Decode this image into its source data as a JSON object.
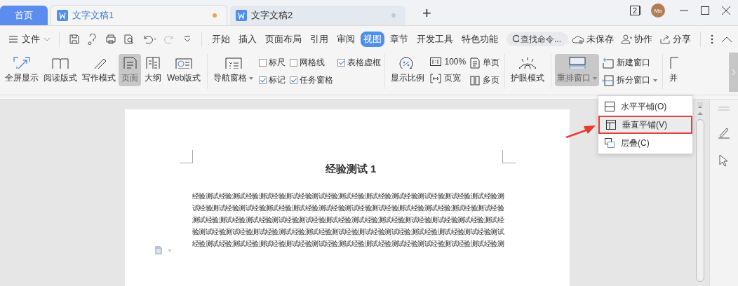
{
  "tab_bar": {
    "home_tab": "首页",
    "doc_tabs": [
      {
        "title": "文字文稿1",
        "selected": true,
        "modified": true
      },
      {
        "title": "文字文稿2",
        "selected": false,
        "modified": false
      }
    ],
    "add_tab": "+",
    "window_count": "2",
    "avatar": "Ma"
  },
  "menu_bar": {
    "file_menu": "文件",
    "tabs": [
      {
        "label": "开始",
        "selected": false
      },
      {
        "label": "插入",
        "selected": false
      },
      {
        "label": "页面布局",
        "selected": false
      },
      {
        "label": "引用",
        "selected": false
      },
      {
        "label": "审阅",
        "selected": false
      },
      {
        "label": "视图",
        "selected": true
      },
      {
        "label": "章节",
        "selected": false
      },
      {
        "label": "开发工具",
        "selected": false
      },
      {
        "label": "特色功能",
        "selected": false
      }
    ],
    "search": {
      "placeholder": "查找命令..."
    },
    "actions": [
      "未保存",
      "协作",
      "分享"
    ]
  },
  "ribbon": {
    "view_modes": [
      {
        "label": "全屏显示",
        "selected": false
      },
      {
        "label": "阅读版式",
        "selected": false
      },
      {
        "label": "写作模式",
        "selected": false
      },
      {
        "label": "页面",
        "selected": true
      },
      {
        "label": "大纲",
        "selected": false
      },
      {
        "label": "Web版式",
        "selected": false
      }
    ],
    "nav_pane": "导航窗格",
    "checkboxes": [
      {
        "label": "标尺",
        "checked": false
      },
      {
        "label": "网格线",
        "checked": false
      },
      {
        "label": "表格虚框",
        "checked": true
      },
      {
        "label": "标记",
        "checked": true
      },
      {
        "label": "任务窗格",
        "checked": true
      }
    ],
    "zoom": "显示比例",
    "zoom_options": [
      "100%",
      "页宽"
    ],
    "page_options": [
      "单页",
      "多页"
    ],
    "eye_mode": "护眼模式",
    "arrange": {
      "label": "重排窗口",
      "selected": true
    },
    "window_options": [
      "新建窗口",
      "拆分窗口"
    ],
    "side_by_side": "并"
  },
  "arrange_menu": [
    {
      "label": "水平平铺(O)",
      "selected": false
    },
    {
      "label": "垂直平铺(V)",
      "selected": true
    },
    {
      "label": "层叠(C)",
      "selected": false
    }
  ],
  "document": {
    "title": "经验测试 1",
    "lines": [
      "经验测试经验测试经验测试经验测试经验测试经验测试经验测试经验测试经验测试经验测试经验测试经验测",
      "试经验测试经验测试经验测试经验测试经验测试经验测试经验测试经验测试经验测试经验测试经验测试经验",
      "测试经验测试经验测试经验测试经验测试经验测试经验测试经验测试经验测试经验测试经验测试经验测试经",
      "验测试经验测试经验测试经验测试经验测试经验测试经验测试经验测试经验测试经验测试经验测试经验测试",
      "经验测试经验测试经验测试经验测试经验测试经验测试经验测试经验测试经验测试经验测试经验测试经验测"
    ]
  }
}
